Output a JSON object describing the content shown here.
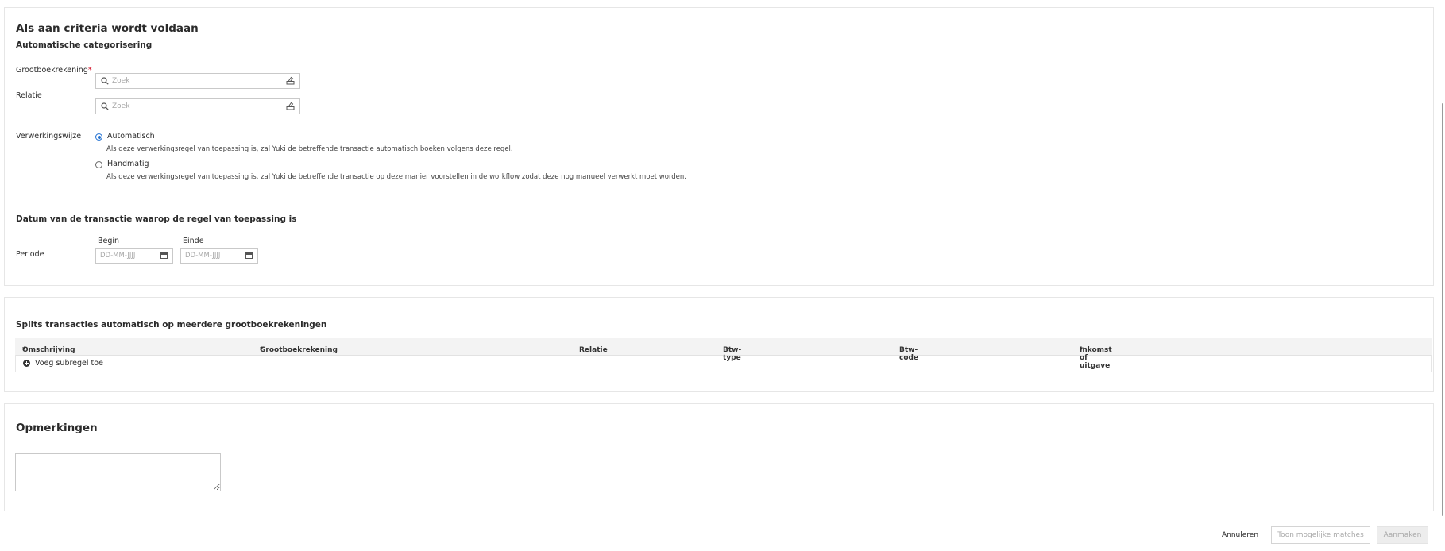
{
  "criteria": {
    "title": "Als aan criteria wordt voldaan",
    "subtitle": "Automatische categorisering",
    "fields": {
      "grootboekrekening": {
        "label": "Grootboekrekening",
        "required_mark": "*",
        "placeholder": "Zoek",
        "value": ""
      },
      "relatie": {
        "label": "Relatie",
        "placeholder": "Zoek",
        "value": ""
      }
    },
    "verwerkingswijze": {
      "label": "Verwerkingswijze",
      "selected": "automatisch",
      "options": [
        {
          "label": "Automatisch",
          "description": "Als deze verwerkingsregel van toepassing is, zal Yuki de betreffende transactie automatisch boeken volgens deze regel."
        },
        {
          "label": "Handmatig",
          "description": "Als deze verwerkingsregel van toepassing is, zal Yuki de betreffende transactie op deze manier voorstellen in de workflow zodat deze nog manueel verwerkt moet worden."
        }
      ]
    },
    "date_section": {
      "title": "Datum van de transactie waarop de regel van toepassing is",
      "periode_label": "Periode",
      "begin": {
        "label": "Begin",
        "placeholder": "DD-MM-JJJJ",
        "value": ""
      },
      "einde": {
        "label": "Einde",
        "placeholder": "DD-MM-JJJJ",
        "value": ""
      }
    }
  },
  "split": {
    "title": "Splits transacties automatisch op meerdere grootboekrekeningen",
    "columns": [
      {
        "label": "Omschrijving",
        "required_mark": "*"
      },
      {
        "label": "Grootboekrekening",
        "required_mark": "*"
      },
      {
        "label": "Relatie",
        "required_mark": ""
      },
      {
        "label": "Btw-type",
        "required_mark": ""
      },
      {
        "label": "Btw-code",
        "required_mark": ""
      },
      {
        "label": "Inkomst of uitgave",
        "required_mark": "*"
      }
    ],
    "add_row_label": "Voeg subregel toe"
  },
  "notes": {
    "title": "Opmerkingen",
    "value": ""
  },
  "footer": {
    "cancel_label": "Annuleren",
    "matches_label": "Toon mogelijke matches",
    "create_label": "Aanmaken"
  },
  "colors": {
    "accent": "#1f6fd1",
    "required": "#d0021b",
    "border": "#c9c9c9",
    "disabled_text": "#a9a9a9"
  },
  "icons": {
    "search": "search-icon",
    "lookup": "lookup-icon",
    "calendar": "calendar-icon",
    "add": "plus-circle-icon"
  }
}
